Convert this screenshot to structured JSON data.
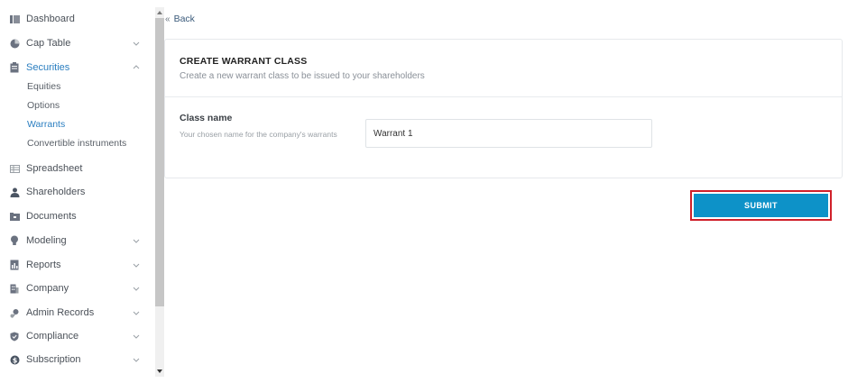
{
  "sidebar": {
    "items": [
      {
        "label": "Dashboard",
        "icon": "dashboard-icon"
      },
      {
        "label": "Cap Table",
        "icon": "pie-chart-icon"
      },
      {
        "label": "Securities",
        "icon": "clipboard-icon"
      },
      {
        "label": "Spreadsheet",
        "icon": "spreadsheet-icon"
      },
      {
        "label": "Shareholders",
        "icon": "person-icon"
      },
      {
        "label": "Documents",
        "icon": "document-icon"
      },
      {
        "label": "Modeling",
        "icon": "lightbulb-icon"
      },
      {
        "label": "Reports",
        "icon": "report-icon"
      },
      {
        "label": "Company",
        "icon": "building-icon"
      },
      {
        "label": "Admin Records",
        "icon": "admin-icon"
      },
      {
        "label": "Compliance",
        "icon": "shield-icon"
      },
      {
        "label": "Subscription",
        "icon": "dollar-icon"
      }
    ],
    "securities_sub": [
      {
        "label": "Equities"
      },
      {
        "label": "Options"
      },
      {
        "label": "Warrants"
      },
      {
        "label": "Convertible instruments"
      }
    ]
  },
  "back": {
    "label": "Back"
  },
  "form": {
    "title": "CREATE WARRANT CLASS",
    "subtitle": "Create a new warrant class to be issued to your shareholders",
    "class_name": {
      "label": "Class name",
      "help": "Your chosen name for the company's warrants",
      "value": "Warrant 1"
    },
    "submit_label": "SUBMIT"
  },
  "colors": {
    "accent": "#2a7ec0",
    "submit_bg": "#0d92c8",
    "highlight_border": "#d0202a"
  }
}
